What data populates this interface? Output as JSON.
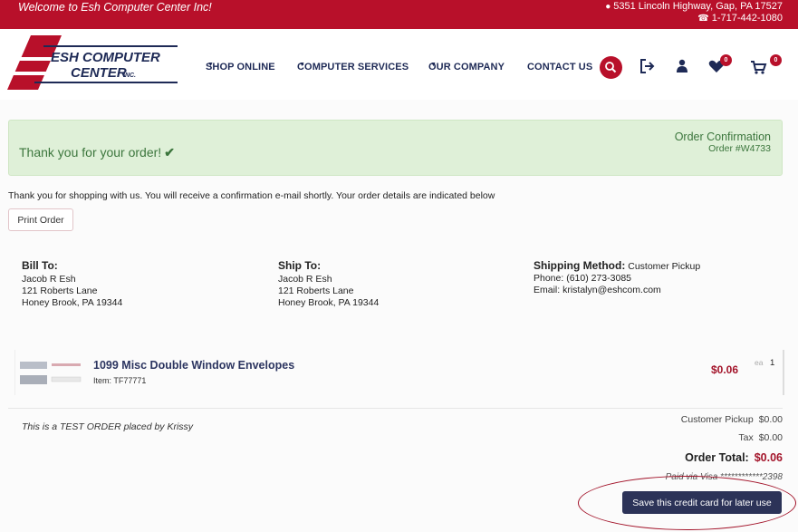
{
  "topbar": {
    "welcome": "Welcome to Esh Computer Center Inc!",
    "address": "5351 Lincoln Highway, Gap, PA 17527",
    "phone": "1-717-442-1080"
  },
  "logo": {
    "line1": "ESH COMPUTER",
    "line2": "CENTER",
    "inc": "INC."
  },
  "nav": {
    "shop": "SHOP ONLINE",
    "services": "COMPUTER SERVICES",
    "company": "OUR COMPANY",
    "contact": "CONTACT US"
  },
  "header": {
    "wishlist_count": "0",
    "cart_count": "0"
  },
  "confirmation": {
    "thanks": "Thank you for your order!",
    "title": "Order Confirmation",
    "order_number": "Order #W4733"
  },
  "message": "Thank you for shopping with us. You will receive a confirmation e-mail shortly. Your order details are indicated below",
  "print_button": "Print Order",
  "bill_to": {
    "heading": "Bill To:",
    "name": "Jacob R Esh",
    "street": "121 Roberts Lane",
    "city": "Honey Brook, PA 19344"
  },
  "ship_to": {
    "heading": "Ship To:",
    "name": "Jacob R Esh",
    "street": "121 Roberts Lane",
    "city": "Honey Brook, PA 19344"
  },
  "shipping": {
    "heading": "Shipping Method:",
    "method": "Customer Pickup",
    "phone": "Phone: (610) 273-3085",
    "email": "Email: kristalyn@eshcom.com"
  },
  "item": {
    "name": "1099 Misc Double Window Envelopes",
    "number": "Item: TF77771",
    "price": "$0.06",
    "unit": "ea",
    "qty": "1"
  },
  "note": "This is a TEST ORDER placed by Krissy",
  "totals": {
    "shipping_label": "Customer Pickup",
    "shipping_value": "$0.00",
    "tax_label": "Tax",
    "tax_value": "$0.00",
    "total_label": "Order Total:",
    "total_value": "$0.06",
    "paid": "Paid via Visa ************2398"
  },
  "save_card_button": "Save this credit card for later use",
  "colors": {
    "brand_red": "#b8102a",
    "navy": "#2c3358",
    "success_bg": "#dff0d8",
    "success_text": "#3c763d"
  }
}
